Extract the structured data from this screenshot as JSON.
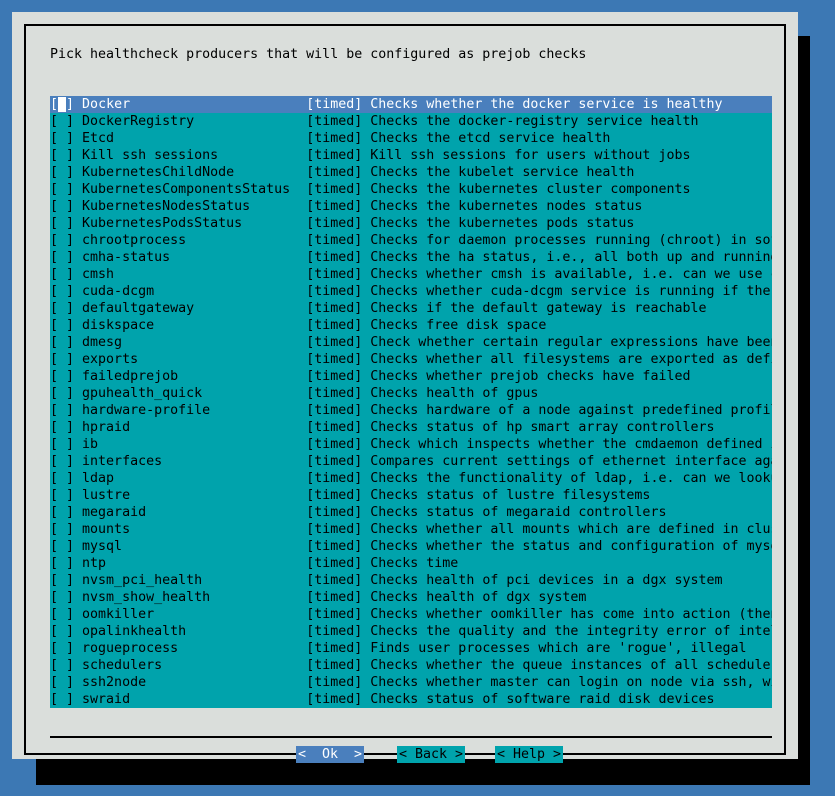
{
  "dialog": {
    "prompt": "Pick healthcheck producers that will be configured as prejob checks"
  },
  "list": {
    "checkbox_unchecked": "[ ]",
    "checkbox_cursor_left": "[",
    "checkbox_cursor_mid": " ",
    "checkbox_cursor_right": "]",
    "tag": "[timed]",
    "items": [
      {
        "name": "Docker",
        "tag": "[timed]",
        "desc": "Checks whether the docker service is healthy",
        "checked": false,
        "selected": true
      },
      {
        "name": "DockerRegistry",
        "tag": "[timed]",
        "desc": "Checks the docker-registry service health",
        "checked": false,
        "selected": false
      },
      {
        "name": "Etcd",
        "tag": "[timed]",
        "desc": "Checks the etcd service health",
        "checked": false,
        "selected": false
      },
      {
        "name": "Kill ssh sessions",
        "tag": "[timed]",
        "desc": "Kill ssh sessions for users without jobs",
        "checked": false,
        "selected": false
      },
      {
        "name": "KubernetesChildNode",
        "tag": "[timed]",
        "desc": "Checks the kubelet service health",
        "checked": false,
        "selected": false
      },
      {
        "name": "KubernetesComponentsStatus",
        "tag": "[timed]",
        "desc": "Checks the kubernetes cluster components",
        "checked": false,
        "selected": false
      },
      {
        "name": "KubernetesNodesStatus",
        "tag": "[timed]",
        "desc": "Checks the kubernetes nodes status",
        "checked": false,
        "selected": false
      },
      {
        "name": "KubernetesPodsStatus",
        "tag": "[timed]",
        "desc": "Checks the kubernetes pods status",
        "checked": false,
        "selected": false
      },
      {
        "name": "chrootprocess",
        "tag": "[timed]",
        "desc": "Checks for daemon processes running (chroot) in software image...",
        "checked": false,
        "selected": false
      },
      {
        "name": "cmha-status",
        "tag": "[timed]",
        "desc": "Checks the ha status, i.e., all both up and running?",
        "checked": false,
        "selected": false
      },
      {
        "name": "cmsh",
        "tag": "[timed]",
        "desc": "Checks whether cmsh is available, i.e. can we use cmsh for the...",
        "checked": false,
        "selected": false
      },
      {
        "name": "cuda-dcgm",
        "tag": "[timed]",
        "desc": "Checks whether cuda-dcgm service is running if there are gpus",
        "checked": false,
        "selected": false
      },
      {
        "name": "defaultgateway",
        "tag": "[timed]",
        "desc": "Checks if the default gateway is reachable",
        "checked": false,
        "selected": false
      },
      {
        "name": "diskspace",
        "tag": "[timed]",
        "desc": "Checks free disk space",
        "checked": false,
        "selected": false
      },
      {
        "name": "dmesg",
        "tag": "[timed]",
        "desc": "Check whether certain regular expressions have been found in t...",
        "checked": false,
        "selected": false
      },
      {
        "name": "exports",
        "tag": "[timed]",
        "desc": "Checks whether all filesystems are exported as defined by the ...",
        "checked": false,
        "selected": false
      },
      {
        "name": "failedprejob",
        "tag": "[timed]",
        "desc": "Checks whether prejob checks have failed",
        "checked": false,
        "selected": false
      },
      {
        "name": "gpuhealth_quick",
        "tag": "[timed]",
        "desc": "Checks health of gpus",
        "checked": false,
        "selected": false
      },
      {
        "name": "hardware-profile",
        "tag": "[timed]",
        "desc": "Checks hardware of a node against predefined profile",
        "checked": false,
        "selected": false
      },
      {
        "name": "hpraid",
        "tag": "[timed]",
        "desc": "Checks status of hp smart array controllers",
        "checked": false,
        "selected": false
      },
      {
        "name": "ib",
        "tag": "[timed]",
        "desc": "Check which inspects whether the cmdaemon defined infiniband i...",
        "checked": false,
        "selected": false
      },
      {
        "name": "interfaces",
        "tag": "[timed]",
        "desc": "Compares current settings of ethernet interface against suppor...",
        "checked": false,
        "selected": false
      },
      {
        "name": "ldap",
        "tag": "[timed]",
        "desc": "Checks the functionality of ldap, i.e. can we lookup the id of...",
        "checked": false,
        "selected": false
      },
      {
        "name": "lustre",
        "tag": "[timed]",
        "desc": "Checks status of lustre filesystems",
        "checked": false,
        "selected": false
      },
      {
        "name": "megaraid",
        "tag": "[timed]",
        "desc": "Checks status of megaraid controllers",
        "checked": false,
        "selected": false
      },
      {
        "name": "mounts",
        "tag": "[timed]",
        "desc": "Checks whether all mounts which are defined in cluster manager...",
        "checked": false,
        "selected": false
      },
      {
        "name": "mysql",
        "tag": "[timed]",
        "desc": "Checks whether the status and configuration of mysql is correc...",
        "checked": false,
        "selected": false
      },
      {
        "name": "ntp",
        "tag": "[timed]",
        "desc": "Checks time",
        "checked": false,
        "selected": false
      },
      {
        "name": "nvsm_pci_health",
        "tag": "[timed]",
        "desc": "Checks health of pci devices in a dgx system",
        "checked": false,
        "selected": false
      },
      {
        "name": "nvsm_show_health",
        "tag": "[timed]",
        "desc": "Checks health of dgx system",
        "checked": false,
        "selected": false
      },
      {
        "name": "oomkiller",
        "tag": "[timed]",
        "desc": "Checks whether oomkiller has come into action (then this check...",
        "checked": false,
        "selected": false
      },
      {
        "name": "opalinkhealth",
        "tag": "[timed]",
        "desc": "Checks the quality and the integrity error of intel opa hfi li...",
        "checked": false,
        "selected": false
      },
      {
        "name": "rogueprocess",
        "tag": "[timed]",
        "desc": "Finds user processes which are 'rogue', illegal",
        "checked": false,
        "selected": false
      },
      {
        "name": "schedulers",
        "tag": "[timed]",
        "desc": "Checks whether the queue instances of all schedulers on a node...",
        "checked": false,
        "selected": false
      },
      {
        "name": "ssh2node",
        "tag": "[timed]",
        "desc": "Checks whether master can login on node via ssh, without passw...",
        "checked": false,
        "selected": false
      },
      {
        "name": "swraid",
        "tag": "[timed]",
        "desc": "Checks status of software raid disk devices",
        "checked": false,
        "selected": false
      }
    ]
  },
  "buttons": {
    "ok": "<  Ok  >",
    "back": "< Back >",
    "help": "< Help >",
    "active": "ok"
  },
  "colors": {
    "desktop_background": "#3c78b4",
    "dialog_background": "#dadedb",
    "list_background": "#00a3ac",
    "selection_background": "#4a7fbd",
    "selection_text": "#ffffff",
    "text": "#000000",
    "shadow": "#000000"
  }
}
